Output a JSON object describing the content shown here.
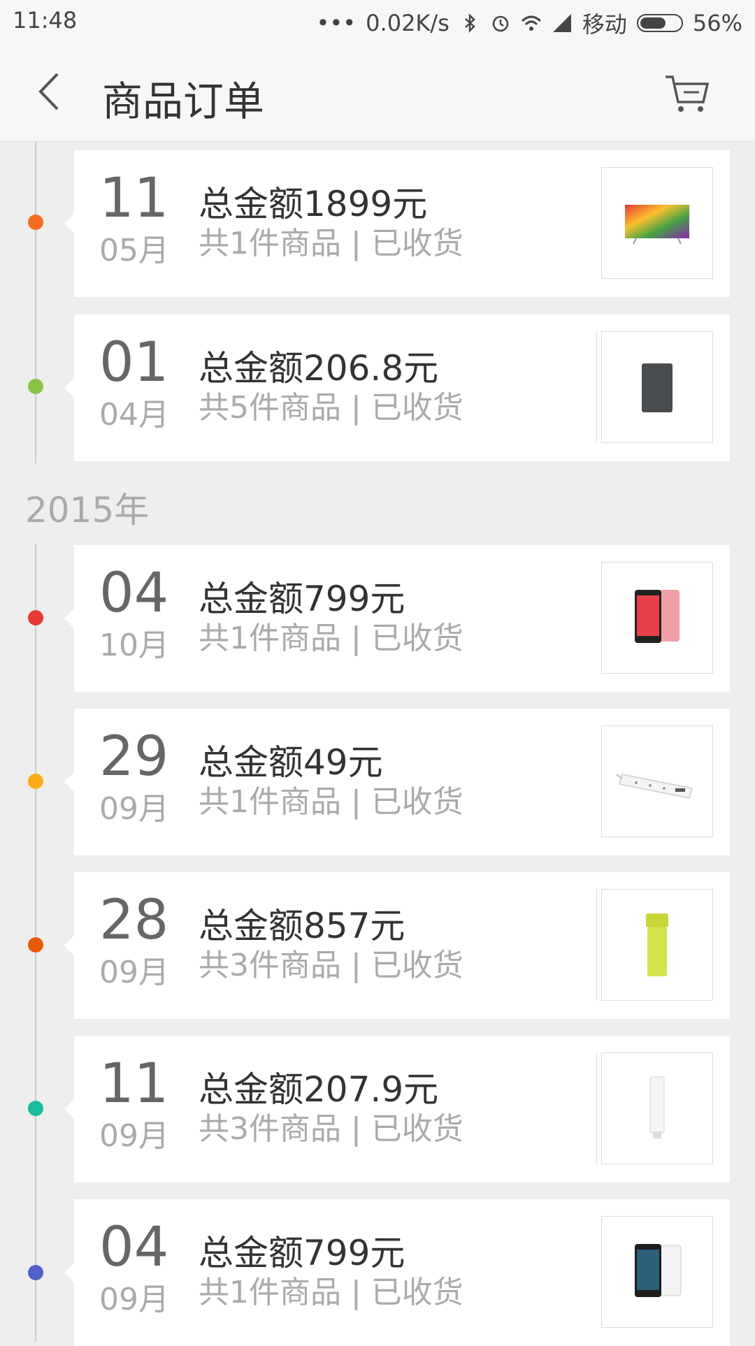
{
  "status_bar": {
    "time": "11:48",
    "more": "•••",
    "speed": "0.02K/s",
    "carrier": "移动",
    "battery": "56%",
    "icons": [
      "bluetooth-icon",
      "alarm-icon",
      "wifi-icon",
      "signal-icon",
      "battery-icon"
    ]
  },
  "header": {
    "title": "商品订单",
    "back_icon": "chevron-left-icon",
    "cart_icon": "cart-icon"
  },
  "timeline": {
    "year_2015": "2015年"
  },
  "orders": [
    {
      "day": "11",
      "month": "05月",
      "amount": "总金额1899元",
      "summary": "共1件商品 | 已收货",
      "dot_color": "#f36c21",
      "product": "tv"
    },
    {
      "day": "01",
      "month": "04月",
      "amount": "总金额206.8元",
      "summary": "共5件商品 | 已收货",
      "dot_color": "#8bc34a",
      "product": "powerbank"
    },
    {
      "day": "04",
      "month": "10月",
      "amount": "总金额799元",
      "summary": "共1件商品 | 已收货",
      "dot_color": "#e53935",
      "product": "phone-pink"
    },
    {
      "day": "29",
      "month": "09月",
      "amount": "总金额49元",
      "summary": "共1件商品 | 已收货",
      "dot_color": "#fbab19",
      "product": "power-strip"
    },
    {
      "day": "28",
      "month": "09月",
      "amount": "总金额857元",
      "summary": "共3件商品 | 已收货",
      "dot_color": "#e8590c",
      "product": "thermos"
    },
    {
      "day": "11",
      "month": "09月",
      "amount": "总金额207.9元",
      "summary": "共3件商品 | 已收货",
      "dot_color": "#1abc9c",
      "product": "wifi-repeater"
    },
    {
      "day": "04",
      "month": "09月",
      "amount": "总金额799元",
      "summary": "共1件商品 | 已收货",
      "dot_color": "#5160c8",
      "product": "phone-white"
    }
  ]
}
